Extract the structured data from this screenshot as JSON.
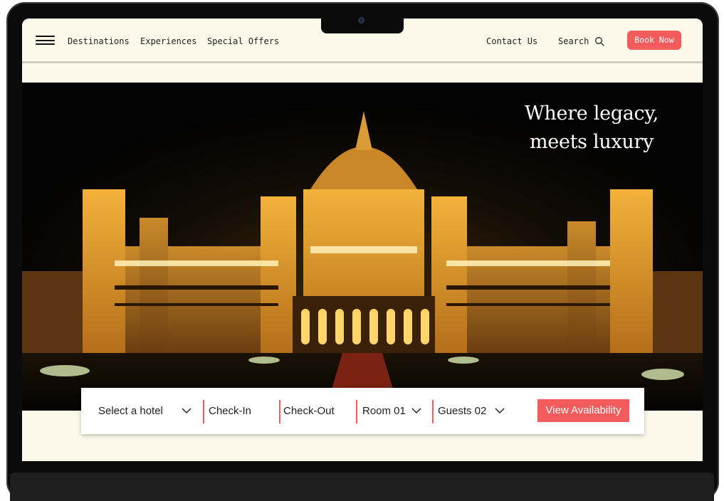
{
  "nav": {
    "links": [
      "Destinations",
      "Experiences",
      "Special Offers"
    ],
    "contact_label": "Contact Us",
    "search_label": "Search",
    "book_label": "Book Now"
  },
  "hero": {
    "tagline_line1": "Where legacy,",
    "tagline_line2": "meets luxury"
  },
  "booking": {
    "hotel_label": "Select a hotel",
    "checkin_label": "Check-In",
    "checkout_label": "Check-Out",
    "room_label": "Room 01",
    "guests_label": "Guests 02",
    "view_label": "View Availability"
  },
  "colors": {
    "accent": "#f25c5c",
    "background": "#fdf9ea",
    "hero_glow": "#e0a534"
  }
}
